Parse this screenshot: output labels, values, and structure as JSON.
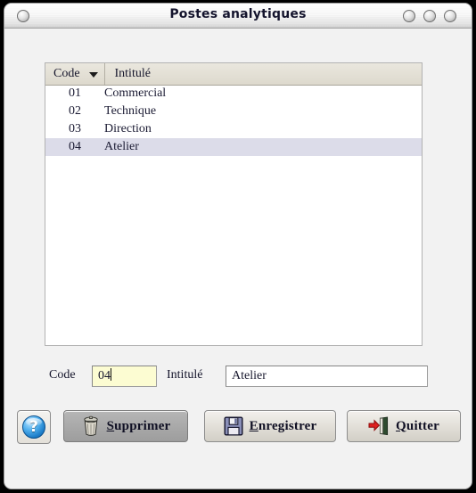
{
  "window": {
    "title": "Postes analytiques",
    "controls": {
      "left_button": "window-menu",
      "buttons": [
        "minimize",
        "maximize",
        "close"
      ]
    }
  },
  "list": {
    "columns": [
      {
        "key": "code",
        "label": "Code",
        "sort": "descending"
      },
      {
        "key": "intitule",
        "label": "Intitulé",
        "sort": "none"
      }
    ],
    "rows": [
      {
        "code": "01",
        "intitule": "Commercial",
        "selected": false
      },
      {
        "code": "02",
        "intitule": "Technique",
        "selected": false
      },
      {
        "code": "03",
        "intitule": "Direction",
        "selected": false
      },
      {
        "code": "04",
        "intitule": "Atelier",
        "selected": true
      }
    ],
    "selected_row_color": "#dcdce9",
    "header_color": "#ddd9cd"
  },
  "form": {
    "code_label": "Code",
    "code_value": "04",
    "code_field_color": "#fcfcd2",
    "intitule_label": "Intitulé",
    "intitule_value": "Atelier",
    "intitule_field_color": "#ffffff"
  },
  "buttons": {
    "help": {
      "icon": "help-question-icon",
      "label": ""
    },
    "delete": {
      "icon": "trash-can-icon",
      "label": "Supprimer",
      "mnemonic": "S"
    },
    "save": {
      "icon": "floppy-disk-icon",
      "label": "Enregistrer",
      "mnemonic": "E"
    },
    "quit": {
      "icon": "exit-door-icon",
      "label": "Quitter",
      "mnemonic": "Q"
    }
  },
  "theme": {
    "window_background": "#f2f2f2",
    "title_text_color": "#14142d",
    "accent_red": "#d81f1f",
    "accent_blue": "#1d7ec9"
  }
}
